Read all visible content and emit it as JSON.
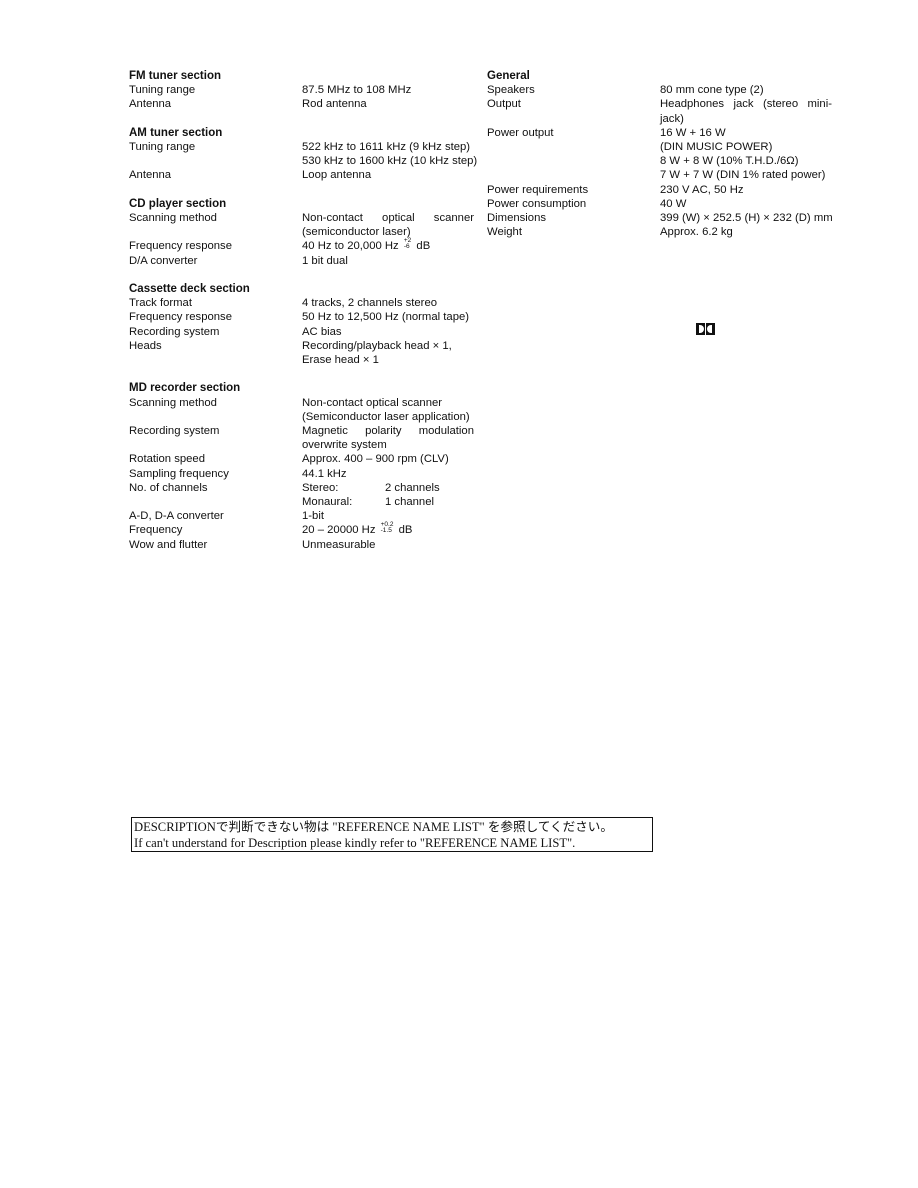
{
  "left_column": [
    {
      "title": "FM tuner section",
      "rows": [
        {
          "label": "Tuning range",
          "lines": [
            "87.5 MHz to 108 MHz"
          ]
        },
        {
          "label": "Antenna",
          "lines": [
            "Rod antenna"
          ]
        }
      ]
    },
    {
      "title": "AM tuner section",
      "rows": [
        {
          "label": "Tuning range",
          "lines": [
            "522 kHz to 1611 kHz (9 kHz step)",
            "530 kHz to 1600 kHz (10 kHz step)"
          ]
        },
        {
          "label": "Antenna",
          "lines": [
            "Loop antenna"
          ]
        }
      ]
    },
    {
      "title": "CD player section",
      "rows": [
        {
          "label": "Scanning method",
          "lines": [
            "Non-contact optical scanner",
            "(semiconductor laser)"
          ]
        },
        {
          "label": "Frequency response",
          "value_prefix": "40 Hz to 20,000 Hz",
          "tol_plus": "+2",
          "tol_minus": "-6",
          "value_suffix": "dB"
        },
        {
          "label": "D/A converter",
          "lines": [
            "1 bit dual"
          ]
        }
      ]
    },
    {
      "title": "Cassette deck section",
      "rows": [
        {
          "label": "Track format",
          "lines": [
            "4 tracks, 2 channels stereo"
          ]
        },
        {
          "label": "Frequency response",
          "lines": [
            "50 Hz to 12,500 Hz (normal tape)"
          ]
        },
        {
          "label": "Recording system",
          "lines": [
            "AC bias"
          ]
        },
        {
          "label": "Heads",
          "lines": [
            "Recording/playback head × 1,",
            "Erase head × 1"
          ]
        }
      ]
    },
    {
      "title": "MD recorder section",
      "rows": [
        {
          "label": "Scanning method",
          "lines": [
            "Non-contact optical scanner",
            "(Semiconductor laser application)"
          ]
        },
        {
          "label": "Recording system",
          "lines": [
            "Magnetic polarity modulation",
            "overwrite system"
          ]
        },
        {
          "label": "Rotation speed",
          "lines": [
            "Approx. 400 – 900 rpm (CLV)"
          ]
        },
        {
          "label": "Sampling frequency",
          "lines": [
            "44.1 kHz"
          ]
        },
        {
          "label": "No. of channels",
          "channels": [
            [
              "Stereo:",
              "2 channels"
            ],
            [
              "Monaural:",
              "1 channel"
            ]
          ]
        },
        {
          "label": "A-D, D-A converter",
          "lines": [
            "1-bit"
          ]
        },
        {
          "label": "Frequency",
          "value_prefix": "20 – 20000 Hz",
          "tol_plus": "+0.2",
          "tol_minus": "-1.5",
          "value_suffix": "dB"
        },
        {
          "label": "Wow and flutter",
          "lines": [
            "Unmeasurable"
          ]
        }
      ]
    }
  ],
  "right_column": {
    "title": "General",
    "rows": [
      {
        "label": "Speakers",
        "lines": [
          "80 mm cone type (2)"
        ]
      },
      {
        "label": "Output",
        "lines": [
          "Headphones jack (stereo mini-",
          "jack)"
        ]
      },
      {
        "label": "Power output",
        "lines": [
          "16 W + 16 W",
          "(DIN MUSIC POWER)",
          "8 W + 8 W (10% T.H.D./6Ω)",
          "7 W + 7 W (DIN 1% rated power)"
        ]
      },
      {
        "label": "Power requirements",
        "lines": [
          "230 V AC, 50 Hz"
        ]
      },
      {
        "label": "Power consumption",
        "lines": [
          "40 W"
        ]
      },
      {
        "label": "Dimensions",
        "lines": [
          "399 (W) × 252.5 (H) × 232 (D) mm"
        ]
      },
      {
        "label": "Weight",
        "lines": [
          "Approx. 6.2 kg"
        ]
      }
    ]
  },
  "logo": {
    "icon": "dolby-double-d-icon"
  },
  "notice": {
    "line1": "DESCRIPTIONで判断できない物は \"REFERENCE NAME LIST\" を参照してください。",
    "line2": "If can't understand for Description please kindly refer to \"REFERENCE NAME LIST\"."
  }
}
